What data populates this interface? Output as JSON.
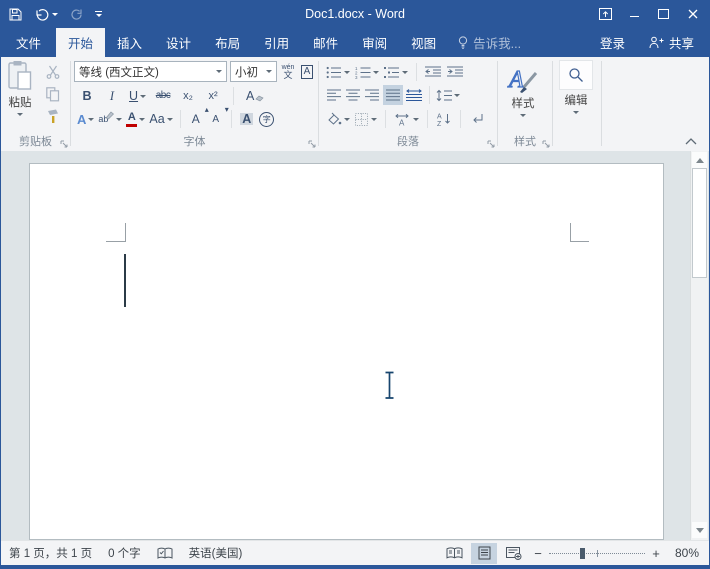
{
  "window": {
    "title": "Doc1.docx - Word"
  },
  "tabs": {
    "file": "文件",
    "items": [
      "开始",
      "插入",
      "设计",
      "布局",
      "引用",
      "邮件",
      "审阅",
      "视图"
    ],
    "active": "开始",
    "tellme": "告诉我...",
    "signin": "登录",
    "share": "共享"
  },
  "ribbon": {
    "clipboard": {
      "group_label": "剪贴板",
      "paste_label": "粘贴"
    },
    "font": {
      "group_label": "字体",
      "name_value": "等线 (西文正文)",
      "size_value": "小初",
      "bold": "B",
      "italic": "I",
      "underline": "U",
      "strikethrough": "abc",
      "subscript": "x₂",
      "superscript": "x²",
      "phonetic_top": "wén",
      "phonetic_bottom": "文",
      "char_border": "A",
      "clear_format": "A",
      "text_effects": "A",
      "highlight": "ab",
      "font_color": "A",
      "change_case": "Aa",
      "grow_font": "A",
      "shrink_font": "A",
      "char_shading": "A",
      "enclose_char": "字"
    },
    "paragraph": {
      "group_label": "段落",
      "numbering_digits": [
        "1",
        "2",
        "3"
      ],
      "sort_a": "A",
      "sort_z": "Z",
      "asian_layout": "A"
    },
    "styles": {
      "group_label": "样式",
      "button_label": "样式"
    },
    "editing": {
      "button_label": "编辑"
    }
  },
  "statusbar": {
    "page": "第 1 页，共 1 页",
    "words": "0 个字",
    "language": "英语(美国)",
    "zoom_minus": "−",
    "zoom_plus": "+",
    "zoom_level": "80%"
  },
  "colors": {
    "accent": "#2b579a",
    "selected_highlight": "#c4d2e0",
    "font_color_red": "#c00000",
    "document_background": "#dee4e7"
  }
}
